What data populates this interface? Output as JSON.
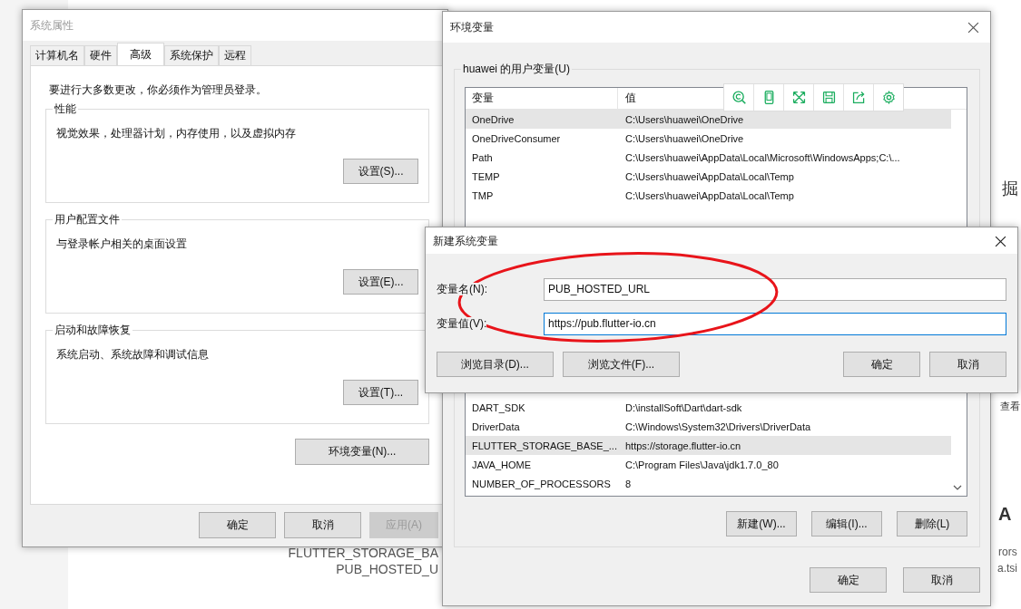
{
  "background_page": {
    "texts": [
      {
        "kind": "big",
        "text": "掘"
      },
      {
        "kind": "normal",
        "text": "查看"
      },
      {
        "kind": "heading",
        "text": "A"
      },
      {
        "kind": "small",
        "text": "rors"
      },
      {
        "kind": "small",
        "text": "a.tsi"
      },
      {
        "kind": "code",
        "text": "FLUTTER_STORAGE_BA"
      },
      {
        "kind": "code",
        "text": "PUB_HOSTED_U"
      }
    ]
  },
  "system_properties": {
    "title": "系统属性",
    "tabs": [
      {
        "label": "计算机名",
        "selected": false
      },
      {
        "label": "硬件",
        "selected": false
      },
      {
        "label": "高级",
        "selected": true
      },
      {
        "label": "系统保护",
        "selected": false
      },
      {
        "label": "远程",
        "selected": false
      }
    ],
    "notice": "要进行大多数更改，你必须作为管理员登录。",
    "groups": [
      {
        "title": "性能",
        "description": "视觉效果，处理器计划，内存使用，以及虚拟内存",
        "button": "设置(S)..."
      },
      {
        "title": "用户配置文件",
        "description": "与登录帐户相关的桌面设置",
        "button": "设置(E)..."
      },
      {
        "title": "启动和故障恢复",
        "description": "系统启动、系统故障和调试信息",
        "button": "设置(T)..."
      }
    ],
    "env_button": "环境变量(N)...",
    "buttons": [
      {
        "label": "确定",
        "disabled": false
      },
      {
        "label": "取消",
        "disabled": false
      },
      {
        "label": "应用(A)",
        "disabled": true
      }
    ]
  },
  "environment_variables": {
    "title": "环境变量",
    "user_section": "huawei 的用户变量(U)",
    "columns": [
      "变量",
      "值"
    ],
    "user_rows": [
      {
        "name": "OneDrive",
        "value": "C:\\Users\\huawei\\OneDrive",
        "selected": true
      },
      {
        "name": "OneDriveConsumer",
        "value": "C:\\Users\\huawei\\OneDrive",
        "selected": false
      },
      {
        "name": "Path",
        "value": "C:\\Users\\huawei\\AppData\\Local\\Microsoft\\WindowsApps;C:\\...",
        "selected": false
      },
      {
        "name": "TEMP",
        "value": "C:\\Users\\huawei\\AppData\\Local\\Temp",
        "selected": false
      },
      {
        "name": "TMP",
        "value": "C:\\Users\\huawei\\AppData\\Local\\Temp",
        "selected": false
      }
    ],
    "system_rows": [
      {
        "name": "DART_SDK",
        "value": "D:\\installSoft\\Dart\\dart-sdk",
        "selected": false
      },
      {
        "name": "DriverData",
        "value": "C:\\Windows\\System32\\Drivers\\DriverData",
        "selected": false
      },
      {
        "name": "FLUTTER_STORAGE_BASE_...",
        "value": "https://storage.flutter-io.cn",
        "selected": true
      },
      {
        "name": "JAVA_HOME",
        "value": "C:\\Program Files\\Java\\jdk1.7.0_80",
        "selected": false
      },
      {
        "name": "NUMBER_OF_PROCESSORS",
        "value": "8",
        "selected": false
      }
    ],
    "row_buttons": [
      "新建(W)...",
      "编辑(I)...",
      "删除(L)"
    ],
    "buttons": [
      "确定",
      "取消"
    ]
  },
  "new_variable_dialog": {
    "title": "新建系统变量",
    "fields": [
      {
        "label": "变量名(N):",
        "value": "PUB_HOSTED_URL",
        "focused": false
      },
      {
        "label": "变量值(V):",
        "value": "https://pub.flutter-io.cn",
        "focused": true
      }
    ],
    "browse_buttons": [
      "浏览目录(D)...",
      "浏览文件(F)..."
    ],
    "buttons": [
      "确定",
      "取消"
    ]
  }
}
